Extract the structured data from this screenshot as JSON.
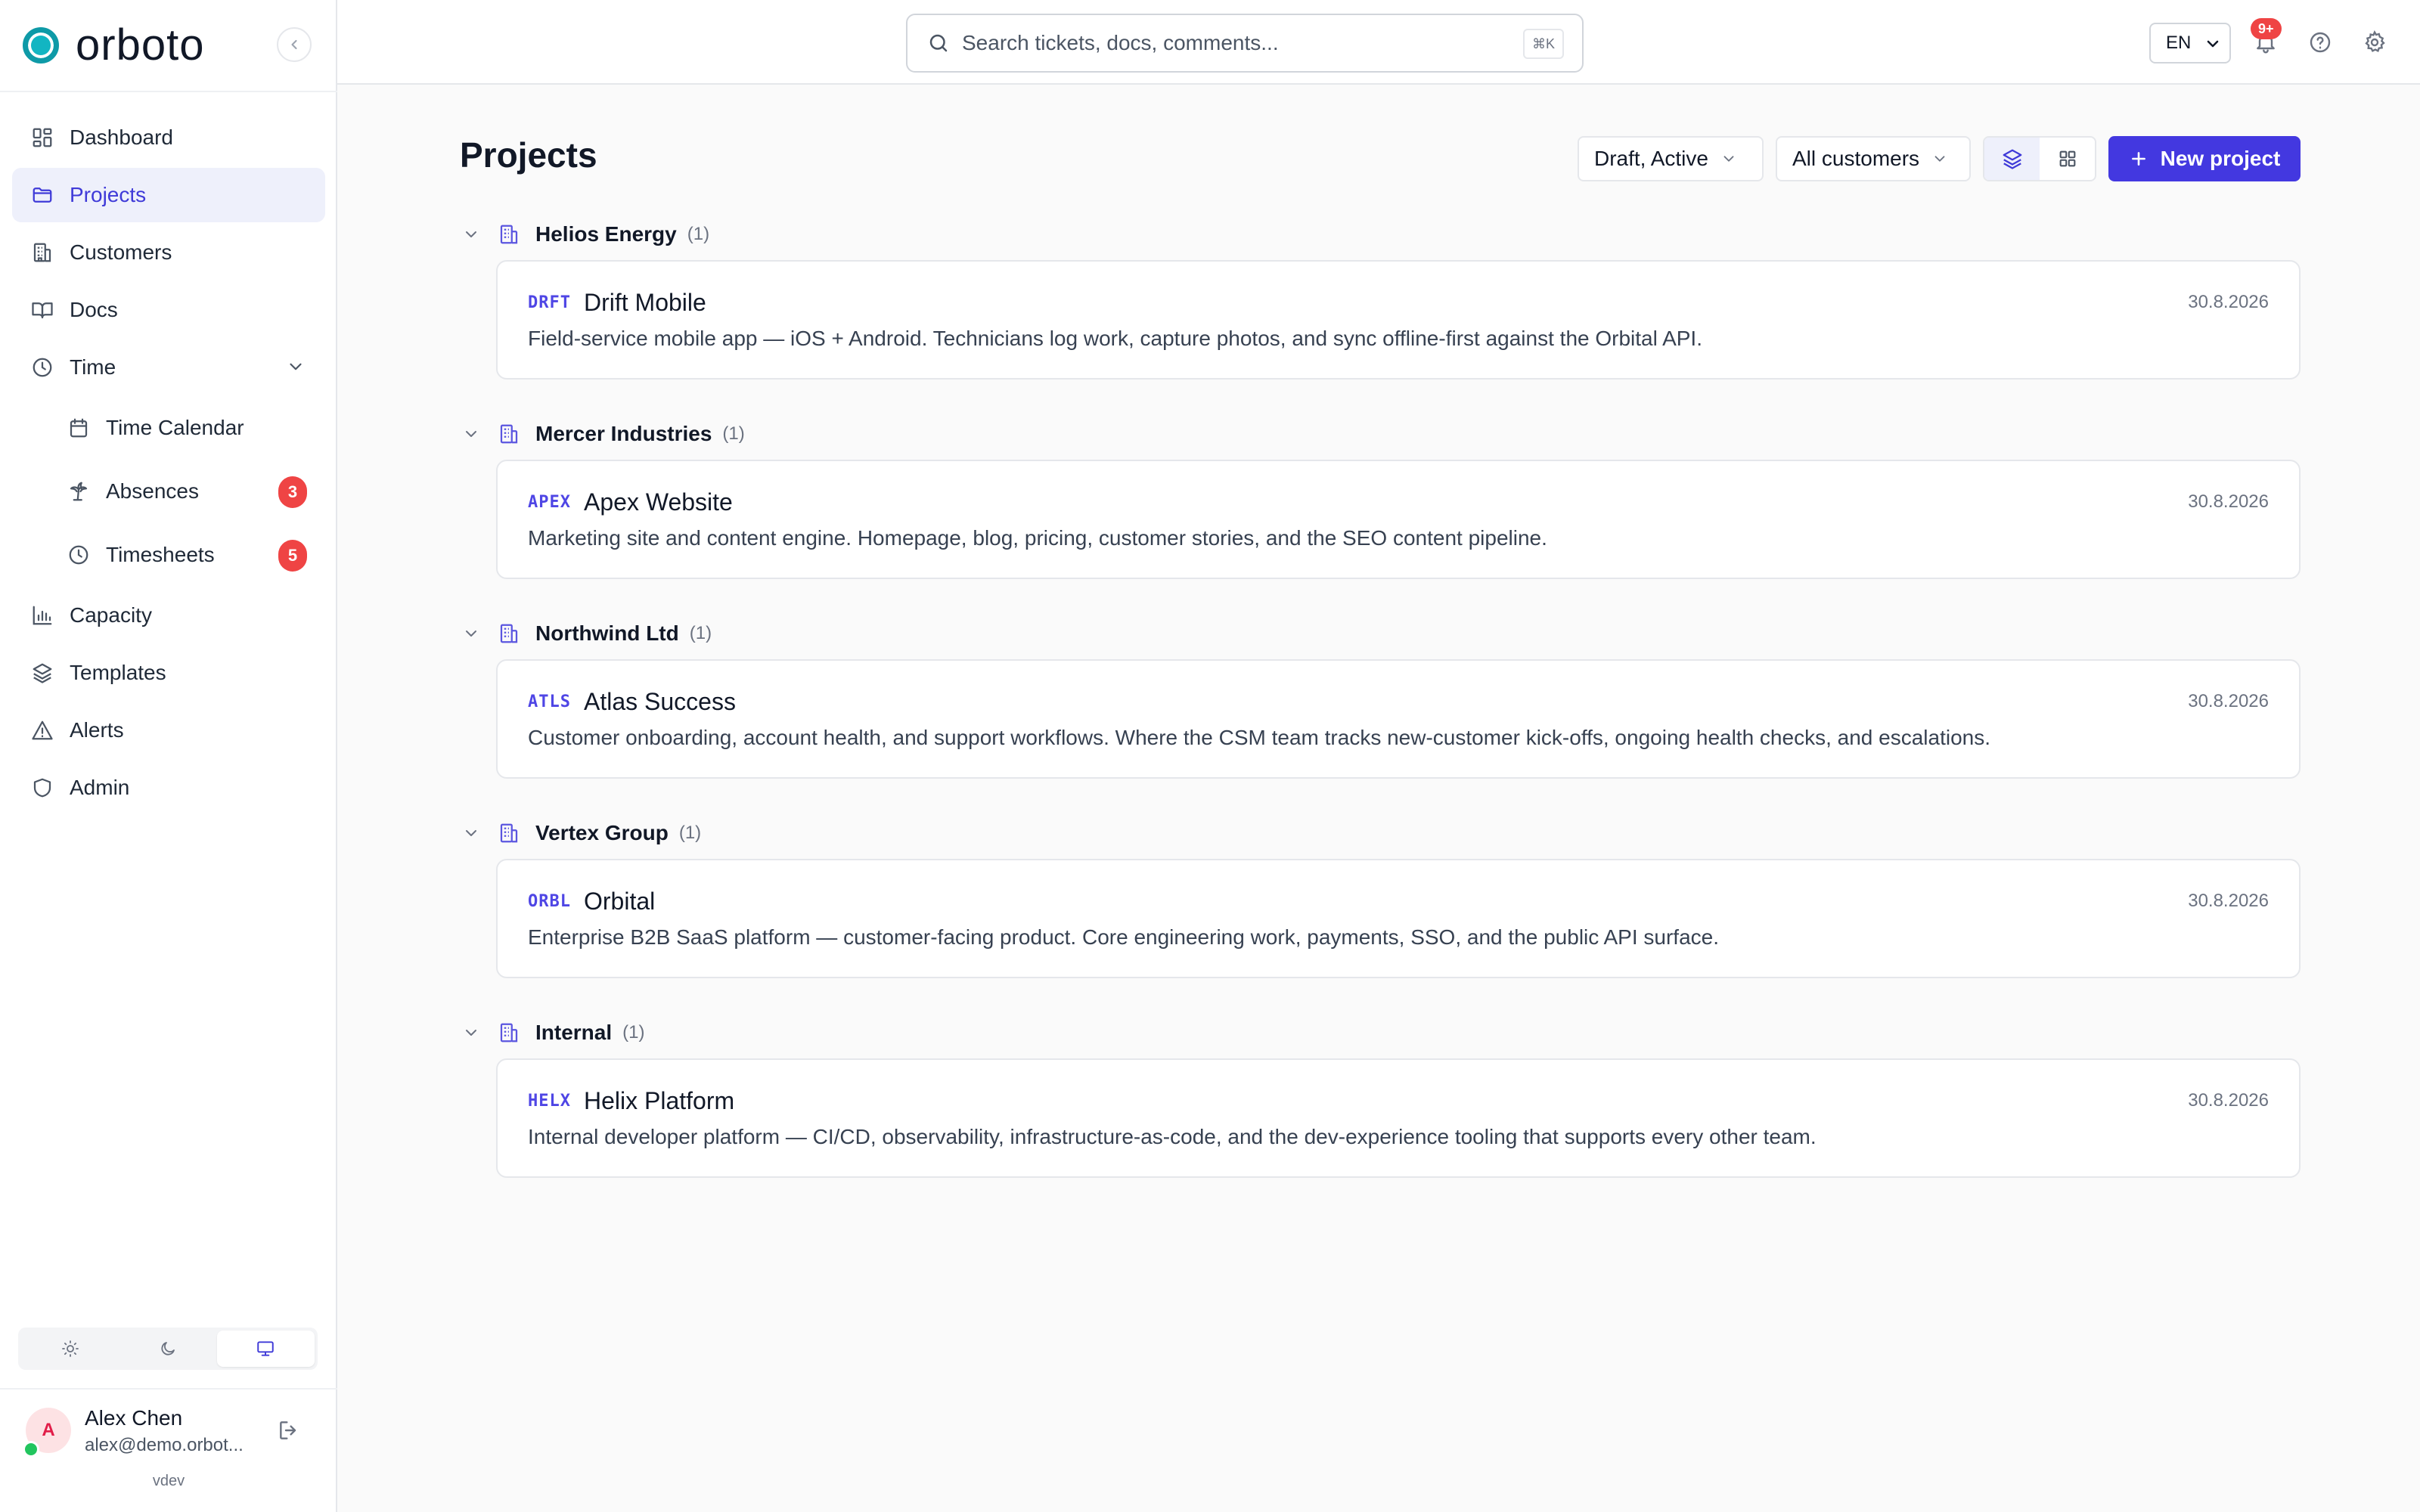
{
  "brand": {
    "name": "orboto"
  },
  "colors": {
    "accent": "#4338e0",
    "badge": "#ef4444",
    "brand": "#0e9aa7"
  },
  "sidebar": {
    "items": [
      {
        "label": "Dashboard",
        "icon": "dashboard-icon"
      },
      {
        "label": "Projects",
        "icon": "folder-icon",
        "active": true
      },
      {
        "label": "Customers",
        "icon": "building-icon"
      },
      {
        "label": "Docs",
        "icon": "book-icon"
      },
      {
        "label": "Time",
        "icon": "clock-icon",
        "expanded": true,
        "children": [
          {
            "label": "Time Calendar",
            "icon": "calendar-icon"
          },
          {
            "label": "Absences",
            "icon": "palm-tree-icon",
            "badge": "3"
          },
          {
            "label": "Timesheets",
            "icon": "clock-icon",
            "badge": "5"
          }
        ]
      },
      {
        "label": "Capacity",
        "icon": "bar-chart-icon"
      },
      {
        "label": "Templates",
        "icon": "layers-icon"
      },
      {
        "label": "Alerts",
        "icon": "warning-icon"
      },
      {
        "label": "Admin",
        "icon": "shield-icon"
      }
    ],
    "theme": {
      "options": [
        "light",
        "dark",
        "system"
      ],
      "selected": "system"
    },
    "user": {
      "initial": "A",
      "name": "Alex Chen",
      "email": "alex@demo.orbot..."
    },
    "version": "vdev"
  },
  "topbar": {
    "search": {
      "placeholder": "Search tickets, docs, comments...",
      "shortcut": "⌘K"
    },
    "language": "EN",
    "notifications_badge": "9+"
  },
  "main": {
    "title": "Projects",
    "filters": {
      "status": "Draft, Active",
      "customer": "All customers"
    },
    "view_mode": "list",
    "new_button": "New project",
    "groups": [
      {
        "name": "Helios Energy",
        "count": "(1)",
        "project": {
          "code": "DRFT",
          "title": "Drift Mobile",
          "description": "Field-service mobile app — iOS + Android. Technicians log work, capture photos, and sync offline-first against the Orbital API.",
          "date": "30.8.2026"
        }
      },
      {
        "name": "Mercer Industries",
        "count": "(1)",
        "project": {
          "code": "APEX",
          "title": "Apex Website",
          "description": "Marketing site and content engine. Homepage, blog, pricing, customer stories, and the SEO content pipeline.",
          "date": "30.8.2026"
        }
      },
      {
        "name": "Northwind Ltd",
        "count": "(1)",
        "project": {
          "code": "ATLS",
          "title": "Atlas Success",
          "description": "Customer onboarding, account health, and support workflows. Where the CSM team tracks new-customer kick-offs, ongoing health checks, and escalations.",
          "date": "30.8.2026"
        }
      },
      {
        "name": "Vertex Group",
        "count": "(1)",
        "project": {
          "code": "ORBL",
          "title": "Orbital",
          "description": "Enterprise B2B SaaS platform — customer-facing product. Core engineering work, payments, SSO, and the public API surface.",
          "date": "30.8.2026"
        }
      },
      {
        "name": "Internal",
        "count": "(1)",
        "project": {
          "code": "HELX",
          "title": "Helix Platform",
          "description": "Internal developer platform — CI/CD, observability, infrastructure-as-code, and the dev-experience tooling that supports every other team.",
          "date": "30.8.2026"
        }
      }
    ]
  }
}
